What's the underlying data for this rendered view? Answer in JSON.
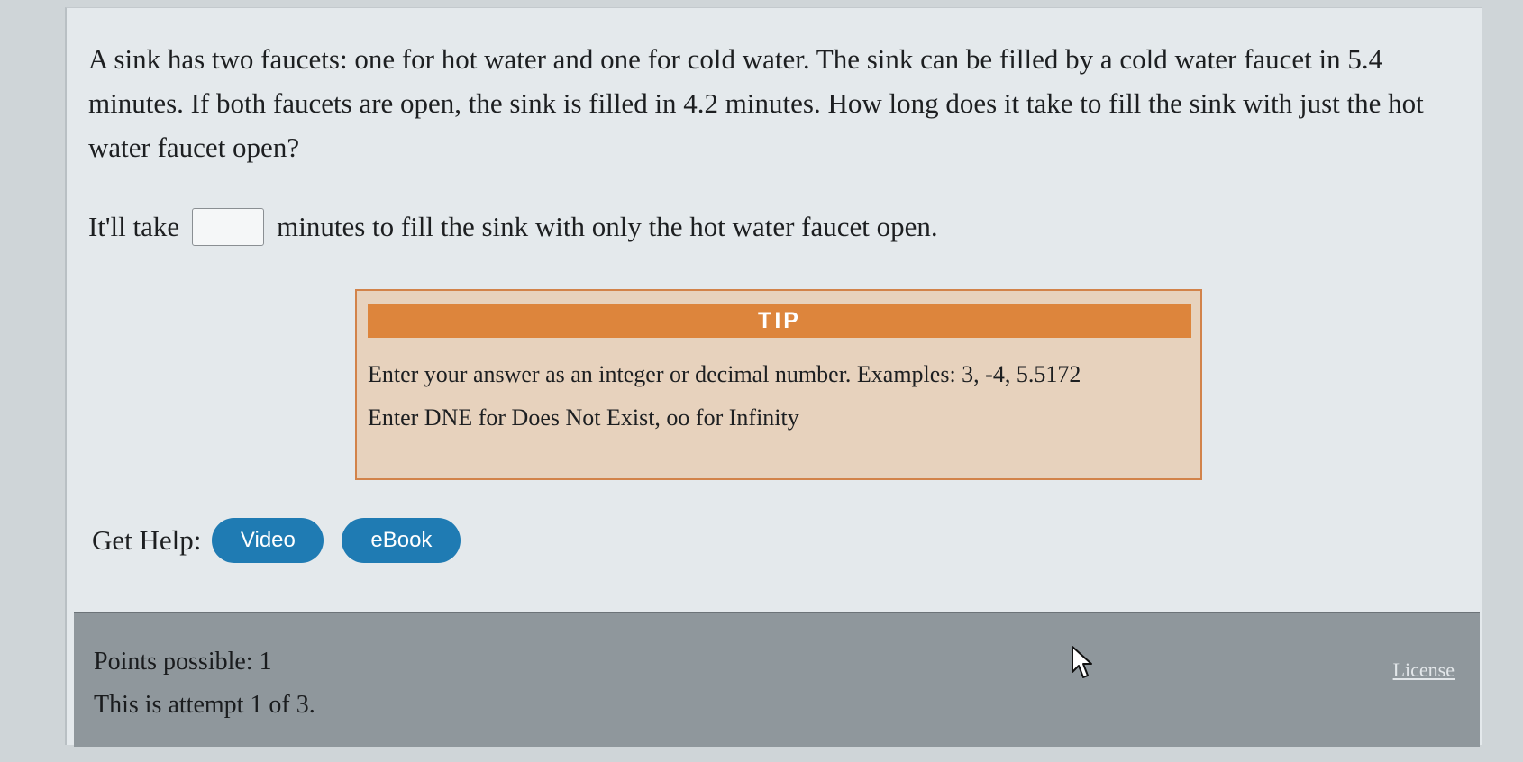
{
  "question": {
    "text": "A sink has two faucets: one for hot water and one for cold water. The sink can be filled by a cold water faucet in 5.4 minutes. If both faucets are open, the sink is filled in 4.2 minutes. How long does it take to fill the sink with just the hot water faucet open?"
  },
  "answer": {
    "prefix": "It'll take",
    "suffix": "minutes to fill the sink with only the hot water faucet open.",
    "value": ""
  },
  "tip": {
    "title": "TIP",
    "line1": "Enter your answer as an integer or decimal number. Examples: 3, -4, 5.5172",
    "line2": "Enter DNE for Does Not Exist, oo for Infinity"
  },
  "help": {
    "label": "Get Help:",
    "video": "Video",
    "ebook": "eBook"
  },
  "footer": {
    "points": "Points possible: 1",
    "attempt": "This is attempt 1 of 3.",
    "license": "License"
  },
  "colors": {
    "tip_header": "#dd853c",
    "tip_background": "#e7d2bd",
    "button": "#1f7bb3",
    "footer": "#8f979c"
  },
  "icons": {
    "cursor": "mouse-pointer-icon"
  }
}
